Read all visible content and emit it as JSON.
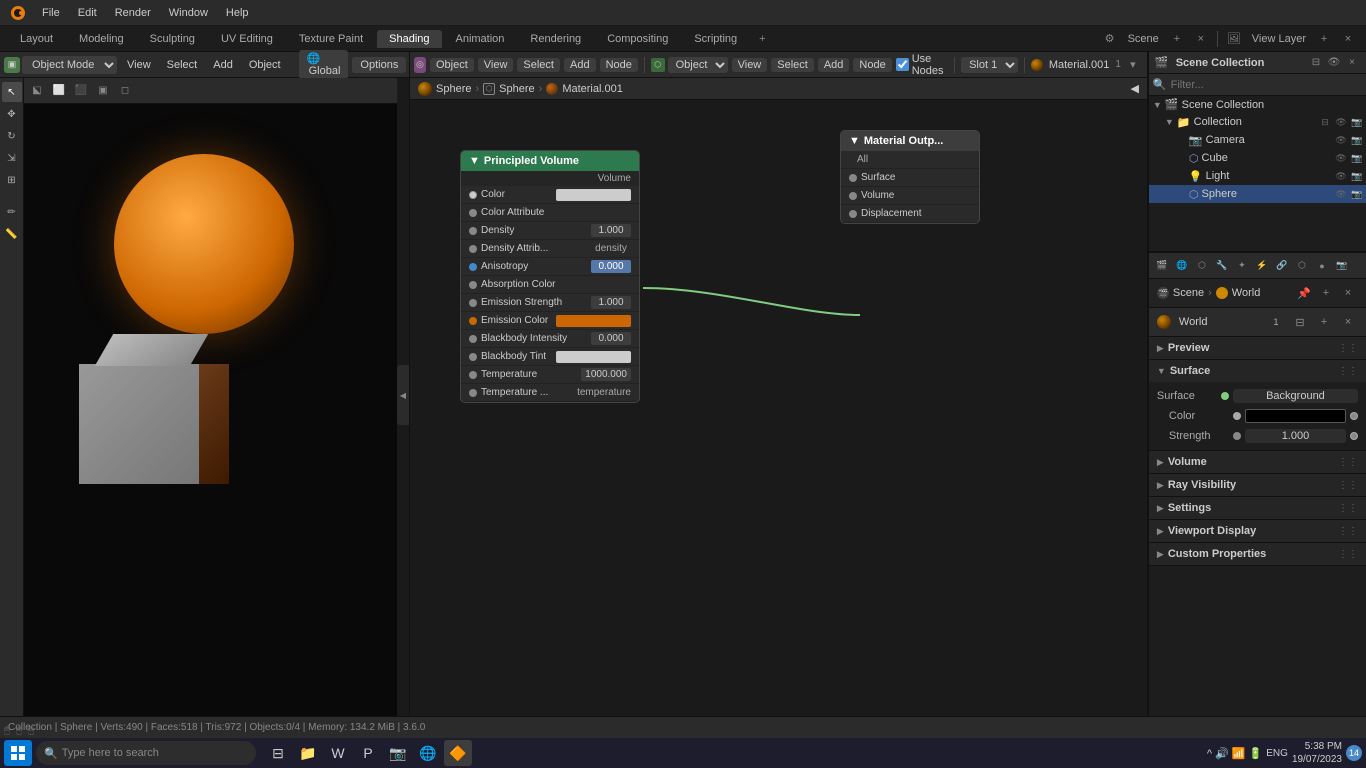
{
  "app": {
    "title": "Blender"
  },
  "topMenu": {
    "items": [
      "Blender",
      "File",
      "Edit",
      "Render",
      "Window",
      "Help"
    ]
  },
  "workspaceTabs": {
    "tabs": [
      "Layout",
      "Modeling",
      "Sculpting",
      "UV Editing",
      "Texture Paint",
      "Shading",
      "Animation",
      "Rendering",
      "Compositing",
      "Scripting"
    ],
    "active": "Shading",
    "scene": "Scene",
    "viewLayer": "View Layer"
  },
  "viewport": {
    "mode": "Object Mode",
    "view": "View",
    "select": "Select",
    "add": "Add",
    "object": "Object",
    "global": "Global",
    "options": "Options"
  },
  "nodeBreadcrumb": {
    "parts": [
      "Sphere",
      "Sphere",
      "Material.001"
    ]
  },
  "nodeToolbar": {
    "object": "Object",
    "view": "View",
    "select": "Select",
    "add": "Add",
    "node": "Node",
    "useNodes": "Use Nodes",
    "slot": "Slot 1",
    "material": "Material.001"
  },
  "nodes": {
    "principledVolume": {
      "title": "Principled Volume",
      "sectionLabel": "Volume",
      "rows": [
        {
          "label": "Color",
          "type": "color",
          "value": "#cccccc",
          "socket": "color"
        },
        {
          "label": "Color Attribute",
          "type": "text",
          "value": "",
          "socket": "value"
        },
        {
          "label": "Density",
          "type": "value",
          "value": "1.000",
          "socket": "value"
        },
        {
          "label": "Density Attrib...",
          "type": "text",
          "value": "density",
          "socket": "value"
        },
        {
          "label": "Anisotropy",
          "type": "value-blue",
          "value": "0.000",
          "socket": "blue"
        },
        {
          "label": "Absorption Color",
          "type": "label",
          "value": "",
          "socket": "value"
        },
        {
          "label": "Emission Strength",
          "type": "value",
          "value": "1.000",
          "socket": "value"
        },
        {
          "label": "Emission Color",
          "type": "color-orange",
          "value": "",
          "socket": "orange"
        },
        {
          "label": "Blackbody Intensity",
          "type": "value",
          "value": "0.000",
          "socket": "value"
        },
        {
          "label": "Blackbody Tint",
          "type": "color",
          "value": "#cccccc",
          "socket": "color"
        },
        {
          "label": "Temperature",
          "type": "value",
          "value": "1000.000",
          "socket": "value"
        },
        {
          "label": "Temperature ...",
          "type": "text",
          "value": "temperature",
          "socket": "value"
        }
      ]
    },
    "materialOutput": {
      "title": "Material Outp...",
      "rows": [
        {
          "label": "All",
          "type": "label"
        },
        {
          "label": "Surface",
          "type": "socket"
        },
        {
          "label": "Volume",
          "type": "socket"
        },
        {
          "label": "Displacement",
          "type": "socket"
        }
      ]
    }
  },
  "outliner": {
    "title": "Scene Collection",
    "items": [
      {
        "name": "Collection",
        "level": 1,
        "expanded": true,
        "type": "collection",
        "icon": "📁"
      },
      {
        "name": "Camera",
        "level": 2,
        "expanded": false,
        "type": "camera",
        "icon": "📷"
      },
      {
        "name": "Cube",
        "level": 2,
        "expanded": false,
        "type": "mesh",
        "icon": "⬡"
      },
      {
        "name": "Light",
        "level": 2,
        "expanded": false,
        "type": "light",
        "icon": "💡"
      },
      {
        "name": "Sphere",
        "level": 2,
        "expanded": false,
        "type": "mesh",
        "icon": "⬡",
        "selected": true
      }
    ]
  },
  "properties": {
    "breadcrumb": [
      "Scene",
      "World"
    ],
    "worldName": "World",
    "sections": [
      {
        "label": "Preview",
        "expanded": false
      },
      {
        "label": "Surface",
        "expanded": true,
        "content": {
          "surfaceLabel": "Surface",
          "backgroundLabel": "Background",
          "color": "#000000",
          "strength": "1.000"
        }
      },
      {
        "label": "Volume",
        "expanded": false
      },
      {
        "label": "Ray Visibility",
        "expanded": false
      },
      {
        "label": "Settings",
        "expanded": false
      },
      {
        "label": "Viewport Display",
        "expanded": false
      },
      {
        "label": "Custom Properties",
        "expanded": false
      }
    ]
  },
  "statusBar": {
    "text": "Collection | Sphere | Verts:490 | Faces:518 | Tris:972 | Objects:0/4 | Memory: 134.2 MiB | 3.6.0"
  },
  "taskbar": {
    "searchPlaceholder": "Type here to search",
    "time": "5:38 PM",
    "date": "19/07/2023",
    "lang": "ENG",
    "notification": "14"
  }
}
